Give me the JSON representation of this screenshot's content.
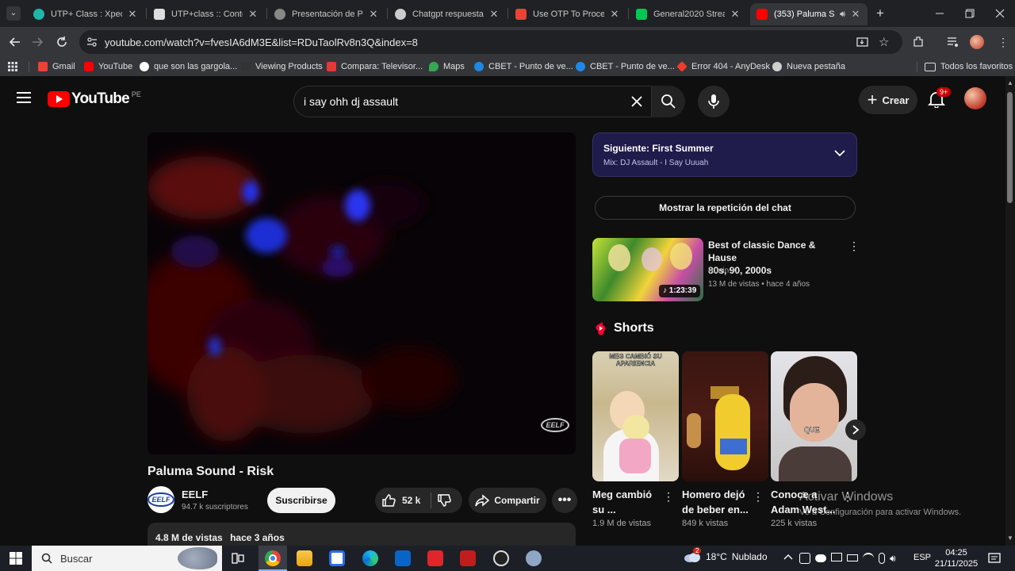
{
  "browser": {
    "tabs": [
      {
        "title": "UTP+ Class : Xpeditio",
        "color": "#1fb5a8"
      },
      {
        "title": "UTP+class :: Contenid",
        "color": "#dddddd"
      },
      {
        "title": "Presentación de Pow",
        "color": "#999999"
      },
      {
        "title": "Chatgpt respuesta a",
        "color": "#cccccc"
      },
      {
        "title": "Use OTP To Proceed",
        "color": "#ea4335"
      },
      {
        "title": "General2020 Stream",
        "color": "#00c853"
      },
      {
        "title": "(353) Paluma S",
        "color": "#ff0000"
      }
    ],
    "url": "youtube.com/watch?v=fvesIA6dM3E&list=RDuTaolRv8n3Q&index=8",
    "bookmarks": [
      {
        "label": "Gmail",
        "color": "#ea4335"
      },
      {
        "label": "YouTube",
        "color": "#ff0000"
      },
      {
        "label": "que son las gargola...",
        "color": "#ffffff"
      },
      {
        "label": "Viewing Products",
        "color": "#333333"
      },
      {
        "label": "Compara: Televisor...",
        "color": "#e53935"
      },
      {
        "label": "Maps",
        "color": "#34a853"
      },
      {
        "label": "CBET - Punto de ve...",
        "color": "#1e88e5"
      },
      {
        "label": "CBET - Punto de ve...",
        "color": "#1e88e5"
      },
      {
        "label": "Error 404 - AnyDesk",
        "color": "#ef3b2c"
      },
      {
        "label": "Nueva pestaña",
        "color": "#cfcfcf"
      }
    ],
    "all_bookmarks": "Todos los favoritos"
  },
  "youtube": {
    "logo": "YouTube",
    "region": "PE",
    "search_query": "i say ohh dj assault",
    "create_label": "Crear",
    "notification_count": "9+",
    "video": {
      "title": "Paluma Sound - Risk",
      "watermark": "EELF",
      "channel": "EELF",
      "subscribers": "94.7 k suscriptores",
      "subscribe_label": "Suscribirse",
      "likes": "52 k",
      "share_label": "Compartir",
      "views": "4.8 M de vistas",
      "age": "hace 3 años"
    },
    "playlist": {
      "next_label": "Siguiente: First Summer",
      "mix_label": "Mix: DJ Assault - I Say Uuuah"
    },
    "chat_replay_label": "Mostrar la repetición del chat",
    "recommended": {
      "title_line1": "Best of classic Dance & Hause",
      "title_line2": "80s, 90, 2000s",
      "channel": "Runin-X",
      "views": "13 M de vistas",
      "age": "hace 4 años",
      "duration": "1:23:39"
    },
    "shorts_heading": "Shorts",
    "shorts": [
      {
        "title": "Meg cambió su ...",
        "views": "1.9 M de vistas",
        "overlay": "MEG CAMBIÓ SU APARIENCIA"
      },
      {
        "title": "Homero dejó de beber en...",
        "views": "849 k vistas",
        "overlay": ""
      },
      {
        "title": "Conoce a Adam West...",
        "views": "225 k vistas",
        "overlay": "QUE"
      }
    ]
  },
  "windows": {
    "activation_title": "Activar Windows",
    "activation_sub": "Ve a Configuración para activar Windows.",
    "search_placeholder": "Buscar",
    "weather_temp": "18°C",
    "weather_desc": "Nublado",
    "language": "ESP",
    "time": "04:25",
    "date": "21/11/2025",
    "weather_badge": "2"
  }
}
